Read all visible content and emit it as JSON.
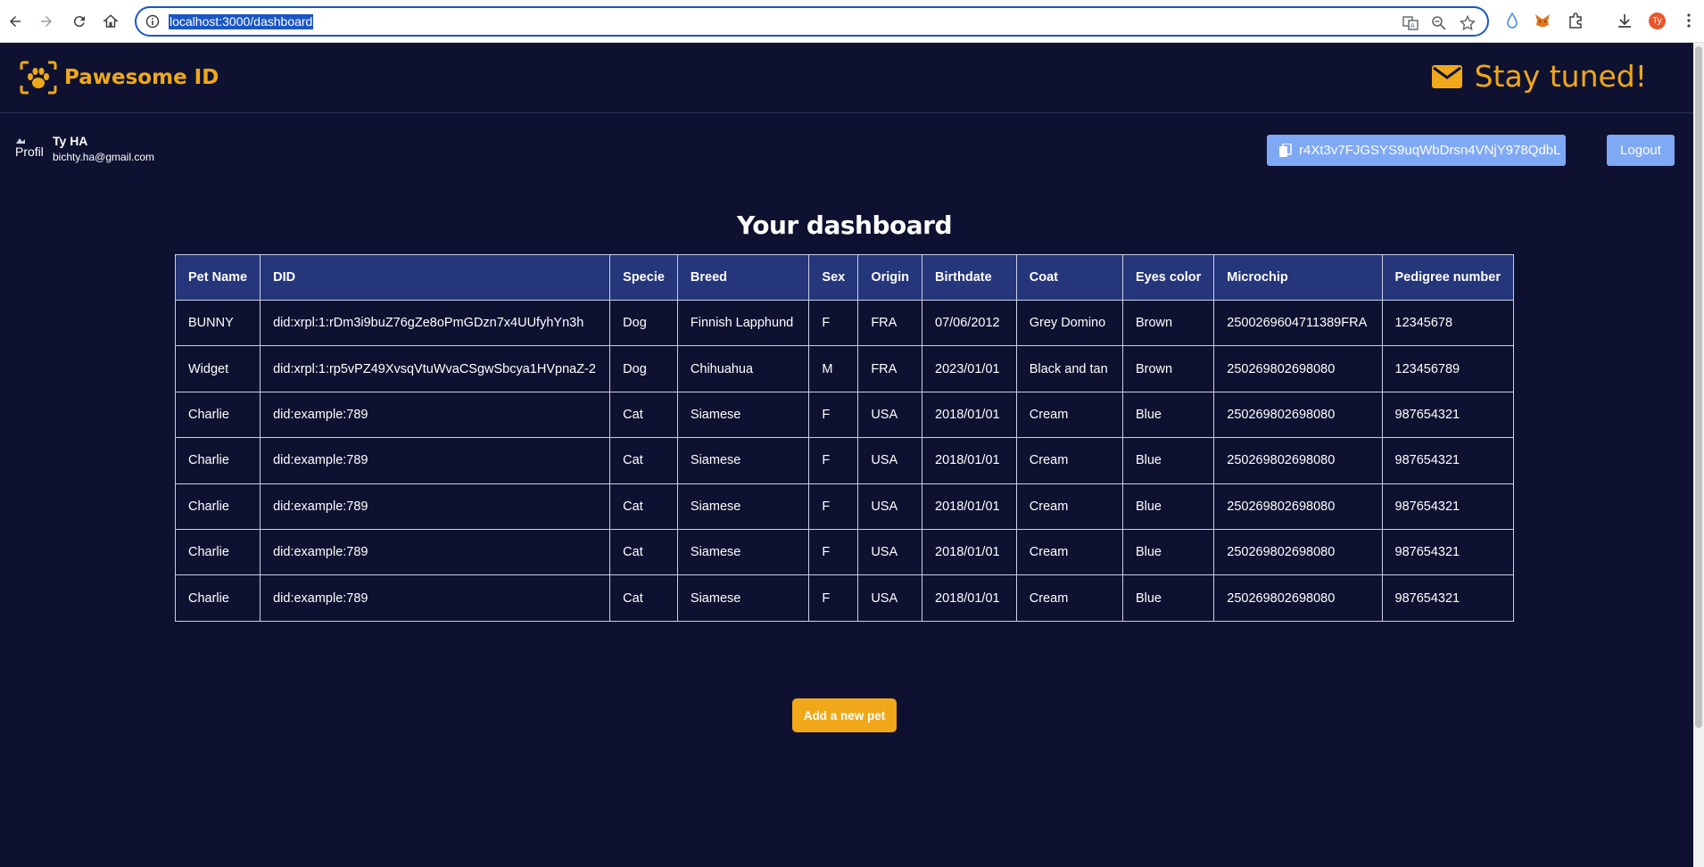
{
  "browser": {
    "url": "localhost:3000/dashboard"
  },
  "header": {
    "brand": "Pawesome ID",
    "stay_tuned": "Stay tuned!"
  },
  "profile": {
    "image_alt": "Profil",
    "name": "Ty HA",
    "email": "bichty.ha@gmail.com",
    "browser_avatar_initials": "Ty"
  },
  "wallet_address": "r4Xt3v7FJGSYS9uqWbDrsn4VNjY978QdbL",
  "logout_label": "Logout",
  "dashboard_title": "Your dashboard",
  "table": {
    "columns": [
      "Pet Name",
      "DID",
      "Specie",
      "Breed",
      "Sex",
      "Origin",
      "Birthdate",
      "Coat",
      "Eyes color",
      "Microchip",
      "Pedigree number"
    ],
    "rows": [
      [
        "BUNNY",
        "did:xrpl:1:rDm3i9buZ76gZe8oPmGDzn7x4UUfyhYn3h",
        "Dog",
        "Finnish Lapphund",
        "F",
        "FRA",
        "07/06/2012",
        "Grey Domino",
        "Brown",
        "2500269604711389FRA",
        "12345678"
      ],
      [
        "Widget",
        "did:xrpl:1:rp5vPZ49XvsqVtuWvaCSgwSbcya1HVpnaZ-2",
        "Dog",
        "Chihuahua",
        "M",
        "FRA",
        "2023/01/01",
        "Black and tan",
        "Brown",
        "250269802698080",
        "123456789"
      ],
      [
        "Charlie",
        "did:example:789",
        "Cat",
        "Siamese",
        "F",
        "USA",
        "2018/01/01",
        "Cream",
        "Blue",
        "250269802698080",
        "987654321"
      ],
      [
        "Charlie",
        "did:example:789",
        "Cat",
        "Siamese",
        "F",
        "USA",
        "2018/01/01",
        "Cream",
        "Blue",
        "250269802698080",
        "987654321"
      ],
      [
        "Charlie",
        "did:example:789",
        "Cat",
        "Siamese",
        "F",
        "USA",
        "2018/01/01",
        "Cream",
        "Blue",
        "250269802698080",
        "987654321"
      ],
      [
        "Charlie",
        "did:example:789",
        "Cat",
        "Siamese",
        "F",
        "USA",
        "2018/01/01",
        "Cream",
        "Blue",
        "250269802698080",
        "987654321"
      ],
      [
        "Charlie",
        "did:example:789",
        "Cat",
        "Siamese",
        "F",
        "USA",
        "2018/01/01",
        "Cream",
        "Blue",
        "250269802698080",
        "987654321"
      ]
    ]
  },
  "add_pet_label": "Add a new pet",
  "colors": {
    "background": "#0e1230",
    "accent": "#f0a81a",
    "button_blue": "#7fa9f5",
    "table_header": "#25367a"
  }
}
